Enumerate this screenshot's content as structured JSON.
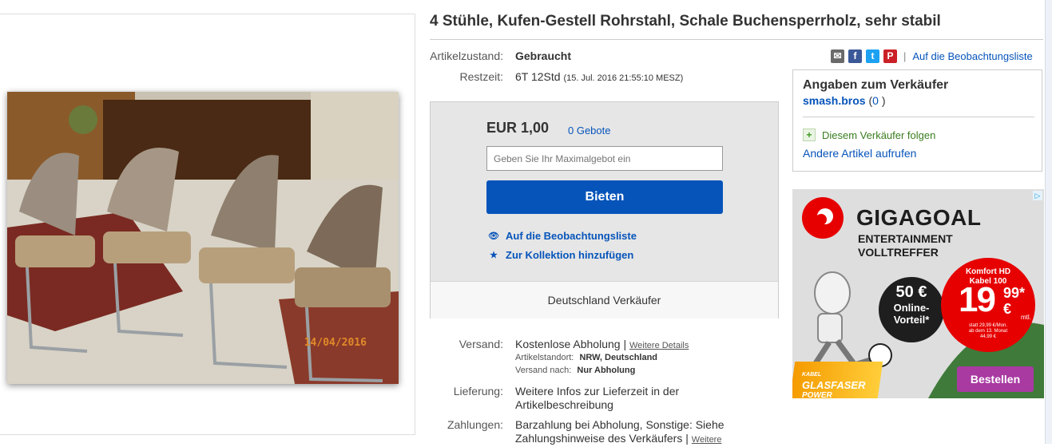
{
  "listing": {
    "title": "4 Stühle, Kufen-Gestell Rohrstahl, Schale Buchensperrholz, sehr stabil",
    "photo_date_stamp": "14/04/2016"
  },
  "details": {
    "condition_label": "Artikelzustand:",
    "condition_value": "Gebraucht",
    "time_label": "Restzeit:",
    "time_value": "6T 12Std",
    "time_end": "(15. Jul. 2016  21:55:10 MESZ)"
  },
  "share": {
    "icons": [
      "mail-icon",
      "facebook-icon",
      "twitter-icon",
      "pinterest-icon"
    ],
    "separator": "|",
    "watch_link": "Auf die Beobachtungsliste"
  },
  "bid": {
    "price": "EUR 1,00",
    "bids": "0 Gebote",
    "max_bid_placeholder": "Geben Sie Ihr Maximalgebot ein",
    "bid_button": "Bieten",
    "watch_action": "Auf die Beobachtungsliste",
    "collection_action": "Zur Kollektion hinzufügen",
    "seller_location": "Deutschland Verkäufer"
  },
  "seller": {
    "heading": "Angaben zum Verkäufer",
    "name": "smash.bros",
    "feedback_open": " (",
    "feedback": "0",
    "feedback_close": " )",
    "follow": "Diesem Verkäufer folgen",
    "other_items": "Andere Artikel aufrufen"
  },
  "shipping": {
    "label": "Versand:",
    "value": "Kostenlose Abholung",
    "separator": "|",
    "details_link": "Weitere Details",
    "location_label": "Artikelstandort:",
    "location_value": "NRW, Deutschland",
    "ship_to_label": "Versand nach:",
    "ship_to_value": "Nur Abholung"
  },
  "delivery": {
    "label": "Lieferung:",
    "value_line1": "Weitere Infos zur Lieferzeit in der",
    "value_line2": "Artikelbeschreibung"
  },
  "payment": {
    "label": "Zahlungen:",
    "value_line1": "Barzahlung bei Abholung,  Sonstige: Siehe",
    "value_line2": "Zahlungshinweise des Verkäufers",
    "separator": "|",
    "more_link": "Weitere"
  },
  "ad": {
    "headline": "GIGAGOAL",
    "subline1": "ENTERTAINMENT",
    "subline2": "VOLLTREFFER",
    "badge_amount": "50 €",
    "badge_text1": "Online-",
    "badge_text2": "Vorteil",
    "badge_star": "*",
    "offer_title1": "Komfort HD",
    "offer_title2": "Kabel 100",
    "offer_price": "19",
    "offer_cents": "99",
    "offer_star": "*",
    "offer_currency": "€",
    "offer_unit": "mtl.",
    "fine1": "statt 29,99 €/Mon.",
    "fine2": "ab dem 13. Monat",
    "fine3": "44,99 €",
    "brand_small": "KABEL",
    "brand1": "GLASFASER",
    "brand2": "POWER",
    "cta": "Bestellen",
    "adchoices_glyph": "▷",
    "colors": {
      "red": "#e60000",
      "purple": "#a83aa2",
      "dark": "#1e1e1e"
    }
  },
  "colors": {
    "link": "#0654ba",
    "bid_button": "#0654ba",
    "follow_green": "#3a7d1f"
  }
}
